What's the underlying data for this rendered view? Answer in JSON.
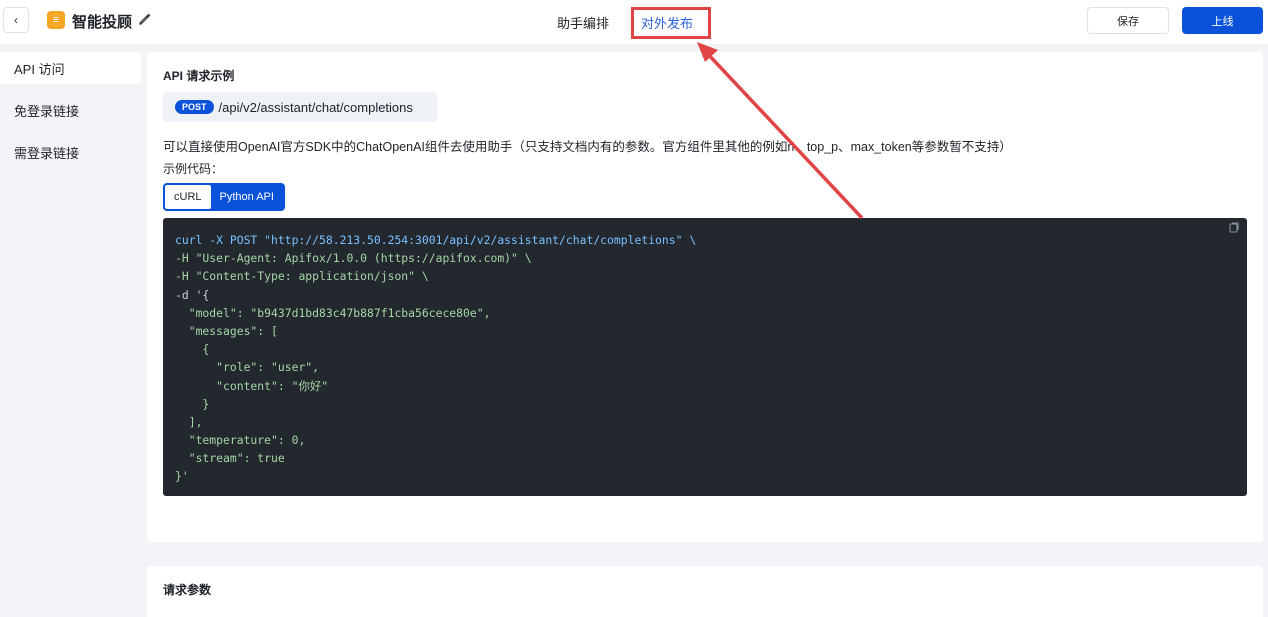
{
  "header": {
    "back_icon": "chevron-left-icon",
    "app_logo_icon": "assistant-logo-icon",
    "app_logo_glyph": "≡",
    "title": "智能投顾",
    "edit_icon": "edit-icon",
    "tabs": [
      {
        "label": "助手编排",
        "active": false
      },
      {
        "label": "对外发布",
        "active": true
      }
    ],
    "save_label": "保存",
    "online_label": "上线"
  },
  "sidebar": {
    "items": [
      {
        "label": "API 访问",
        "active": true
      },
      {
        "label": "免登录链接",
        "active": false
      },
      {
        "label": "需登录链接",
        "active": false
      }
    ]
  },
  "main": {
    "title": "API 请求示例",
    "method": "POST",
    "path": "/api/v2/assistant/chat/completions",
    "description": "可以直接使用OpenAI官方SDK中的ChatOpenAI组件去使用助手（只支持文档内有的参数。官方组件里其他的例如n、top_p、max_token等参数暂不支持）",
    "code_label": "示例代码：",
    "code_tabs": [
      {
        "label": "cURL",
        "active": true
      },
      {
        "label": "Python API",
        "active": false
      }
    ],
    "code_lines": [
      "curl -X POST \"http://58.213.50.254:3001/api/v2/assistant/chat/completions\" \\",
      "-H \"User-Agent: Apifox/1.0.0 (https://apifox.com)\" \\",
      "-H \"Content-Type: application/json\" \\",
      "-d '{",
      "  \"model\": \"b9437d1bd83c47b887f1cba56cece80e\",",
      "  \"messages\": [",
      "    {",
      "      \"role\": \"user\",",
      "      \"content\": \"你好\"",
      "    }",
      "  ],",
      "  \"temperature\": 0,",
      "  \"stream\": true",
      "}'"
    ],
    "copy_icon": "copy-icon"
  },
  "params": {
    "title": "请求参数"
  },
  "colors": {
    "accent": "#0a52d9",
    "highlight": "#e04545",
    "code_bg": "#23272e"
  }
}
